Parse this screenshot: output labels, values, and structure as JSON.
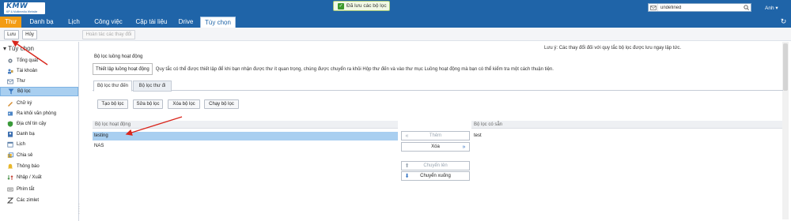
{
  "app": {
    "logo_text": "KMW",
    "logo_tagline": "KP & Multimedia Website",
    "toast": "Đã lưu các bộ lọc",
    "search": {
      "value": "undefined"
    },
    "user": "Anh"
  },
  "tabs": [
    {
      "label": "Thư"
    },
    {
      "label": "Danh bạ"
    },
    {
      "label": "Lịch"
    },
    {
      "label": "Công việc"
    },
    {
      "label": "Cặp tài liệu"
    },
    {
      "label": "Drive"
    },
    {
      "label": "Tùy chọn"
    }
  ],
  "toolbar": {
    "save": "Lưu",
    "cancel": "Hủy",
    "undo": "Hoàn tác các thay đổi"
  },
  "sidebar": {
    "heading": "Tùy chọn",
    "items": [
      {
        "label": "Tổng quát",
        "icon": "gear-icon"
      },
      {
        "label": "Tài khoản",
        "icon": "accounts-icon"
      },
      {
        "label": "Thư",
        "icon": "mail-icon"
      },
      {
        "label": "Bộ lọc",
        "icon": "filter-icon"
      },
      {
        "label": "Chữ ký",
        "icon": "signature-icon"
      },
      {
        "label": "Ra khỏi văn phòng",
        "icon": "out-of-office-icon"
      },
      {
        "label": "Địa chỉ tin cậy",
        "icon": "trusted-icon"
      },
      {
        "label": "Danh bạ",
        "icon": "contacts-icon"
      },
      {
        "label": "Lịch",
        "icon": "calendar-icon"
      },
      {
        "label": "Chia sẻ",
        "icon": "share-icon"
      },
      {
        "label": "Thông báo",
        "icon": "notification-icon"
      },
      {
        "label": "Nhập / Xuất",
        "icon": "import-export-icon"
      },
      {
        "label": "Phím tắt",
        "icon": "shortcut-icon"
      },
      {
        "label": "Các zimlet",
        "icon": "zimlet-icon"
      }
    ]
  },
  "main": {
    "note": "Lưu ý: Các thay đổi đối với quy tắc bộ lọc được lưu ngay lập tức.",
    "section_title": "Bộ lọc luồng hoạt động",
    "active_label": "Thiết lập luồng hoạt động",
    "active_desc": "Quy tắc có thể được thiết lập để khi bạn nhận được thư ít quan trọng, chúng được chuyển ra khỏi Hộp thư đến và vào thư mục Luồng hoạt động mà bạn có thể kiểm tra một cách thuận tiện.",
    "panel_tabs": [
      "Bộ lọc thư đến",
      "Bộ lọc thư đi"
    ],
    "filter_buttons": [
      "Tạo bộ lọc",
      "Sửa bộ lọc",
      "Xóa bộ lọc",
      "Chạy bộ lọc"
    ],
    "active_list_header": "Bộ lọc hoạt động",
    "active_list": [
      "testing",
      "NAS"
    ],
    "available_list_header": "Bộ lọc có sẵn",
    "available_list": [
      "test"
    ],
    "move_buttons": {
      "add": "Thêm",
      "remove": "Xóa",
      "move_up": "Chuyển lên",
      "move_down": "Chuyển xuống"
    }
  },
  "colors": {
    "header_blue": "#1f64a8",
    "mail_tab_orange": "#f39c12",
    "selection_blue": "#a9cff0",
    "annotation_red": "#d9261c"
  }
}
